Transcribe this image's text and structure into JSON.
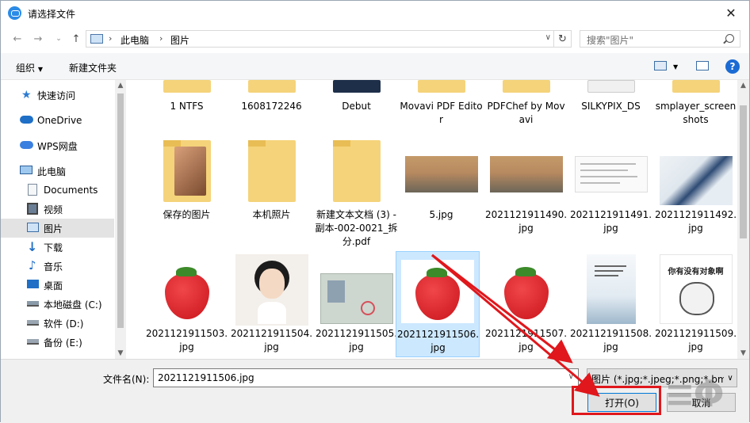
{
  "window": {
    "title": "请选择文件",
    "close": "✕"
  },
  "nav": {
    "path": [
      "此电脑",
      "图片"
    ],
    "search_placeholder": "搜索\"图片\""
  },
  "toolbar": {
    "organize": "组织",
    "new_folder": "新建文件夹"
  },
  "sidebar": {
    "items": [
      {
        "label": "快速访问",
        "icon": "star-icon"
      },
      {
        "label": "OneDrive",
        "icon": "cloud-icon"
      },
      {
        "label": "WPS网盘",
        "icon": "cloud-icon"
      },
      {
        "label": "此电脑",
        "icon": "computer-icon"
      },
      {
        "label": "Documents",
        "icon": "document-icon"
      },
      {
        "label": "视频",
        "icon": "video-icon"
      },
      {
        "label": "图片",
        "icon": "picture-icon",
        "selected": true
      },
      {
        "label": "下载",
        "icon": "download-icon"
      },
      {
        "label": "音乐",
        "icon": "music-icon"
      },
      {
        "label": "桌面",
        "icon": "desktop-icon"
      },
      {
        "label": "本地磁盘 (C:)",
        "icon": "drive-icon"
      },
      {
        "label": "软件 (D:)",
        "icon": "drive-icon"
      },
      {
        "label": "备份 (E:)",
        "icon": "drive-icon"
      }
    ]
  },
  "files": {
    "row1": [
      "1 NTFS",
      "1608172246",
      "Debut",
      "Movavi PDF Editor",
      "PDFChef by Movavi",
      "SILKYPIX_DS",
      "smplayer_screenshots"
    ],
    "row2": [
      "保存的图片",
      "本机照片",
      "新建文本文档 (3) - 副本-002-0021_拆分.pdf",
      "5.jpg",
      "2021121911490.jpg",
      "2021121911491.jpg",
      "2021121911492.jpg"
    ],
    "row3": [
      "2021121911503.jpg",
      "2021121911504.jpg",
      "2021121911505.jpg",
      "2021121911506.jpg",
      "2021121911507.jpg",
      "2021121911508.jpg",
      "2021121911509.jpg"
    ],
    "selected": "2021121911506.jpg",
    "meme_text": "你有没有对象啊"
  },
  "footer": {
    "filename_label": "文件名(N):",
    "filename_value": "2021121911506.jpg",
    "filetype_value": "图片 (*.jpg;*.jpeg;*.png;*.bmp",
    "open_label": "打开(O)",
    "cancel_label": "取消"
  },
  "colors": {
    "accent": "#0078d7",
    "selection": "#cce8ff",
    "annotation": "#e0171c"
  }
}
